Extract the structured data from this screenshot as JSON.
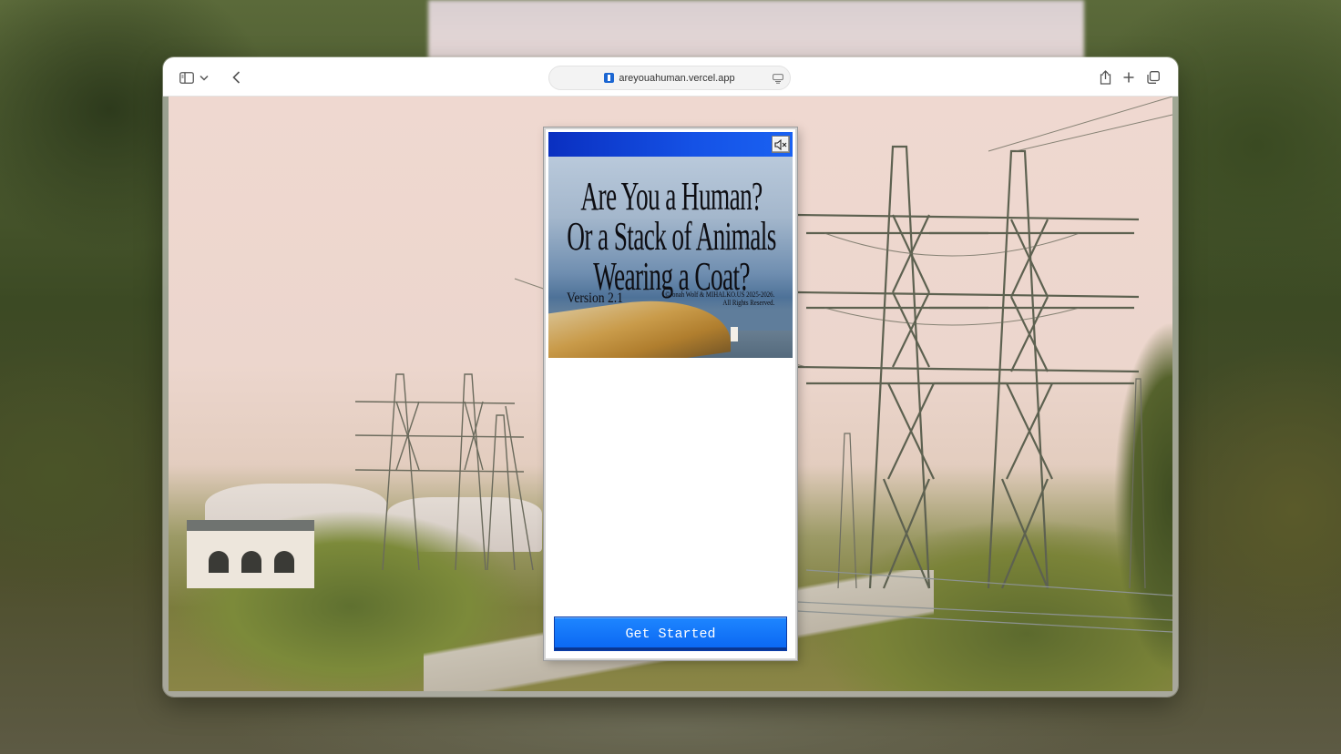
{
  "browser": {
    "url": "areyouahuman.vercel.app",
    "icons": [
      "sidebar-icon",
      "chevron-down-icon",
      "back-icon",
      "reader-icon",
      "share-icon",
      "plus-icon",
      "tabs-icon"
    ]
  },
  "app": {
    "mute_icon": "speaker-muted-icon",
    "title_lines": [
      "Are You a Human?",
      "Or a Stack of Animals",
      "Wearing a Coat?"
    ],
    "version": "Version 2.1",
    "copyright_line1": "©Jonah Wolf & MIHALKO.US 2025-2026.",
    "copyright_line2": "All Rights Reserved.",
    "cta_label": "Get Started"
  },
  "colors": {
    "title_bar": "#1552e6",
    "cta": "#0a66f2"
  }
}
